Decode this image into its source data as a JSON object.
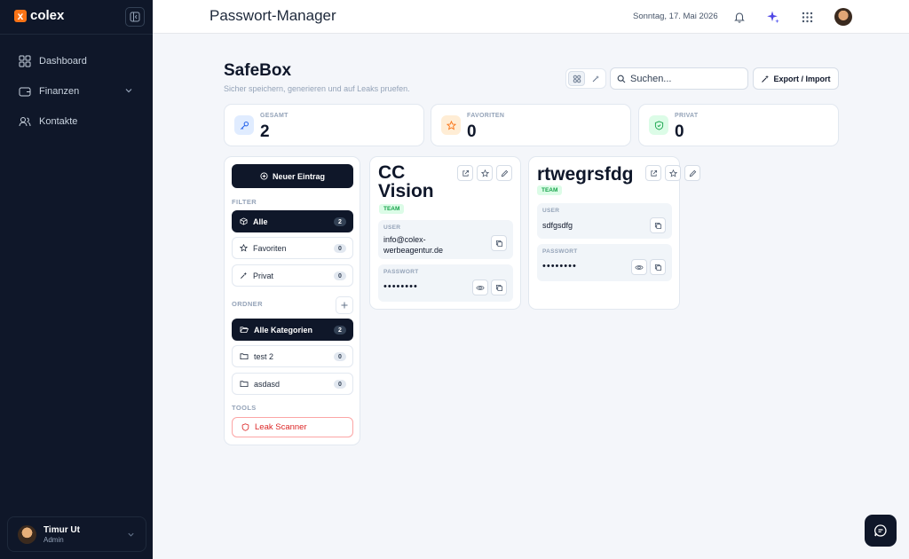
{
  "sidebar": {
    "brand": "colex",
    "brand_mark": "x",
    "nav": [
      {
        "label": "Dashboard",
        "icon": "dashboard-icon"
      },
      {
        "label": "Finanzen",
        "icon": "wallet-icon",
        "has_submenu": true
      },
      {
        "label": "Kontakte",
        "icon": "contacts-icon"
      }
    ],
    "user": {
      "name": "Timur Ut",
      "role": "Admin"
    }
  },
  "header": {
    "title": "Passwort-Manager",
    "date": "Sonntag, 17. Mai 2026"
  },
  "safebox": {
    "title": "SafeBox",
    "subtitle": "Sicher speichern, generieren und auf Leaks pruefen.",
    "search_placeholder": "Suchen...",
    "export_label": "Export / Import"
  },
  "stats": [
    {
      "label": "GESAMT",
      "value": "2",
      "color": "#2563eb"
    },
    {
      "label": "FAVORITEN",
      "value": "0",
      "color": "#f97316"
    },
    {
      "label": "PRIVAT",
      "value": "0",
      "color": "#16a34a"
    }
  ],
  "panel": {
    "new_entry": "Neuer Eintrag",
    "filter_label": "FILTER",
    "filters": [
      {
        "label": "Alle",
        "count": "2"
      },
      {
        "label": "Favoriten",
        "count": "0"
      },
      {
        "label": "Privat",
        "count": "0"
      }
    ],
    "folder_label": "ORDNER",
    "folders": [
      {
        "label": "Alle Kategorien",
        "count": "2"
      },
      {
        "label": "test 2",
        "count": "0"
      },
      {
        "label": "asdasd",
        "count": "0"
      }
    ],
    "tools_label": "TOOLS",
    "leak_scanner": "Leak Scanner"
  },
  "entries": [
    {
      "title_line1": "CC",
      "title_line2": "Vision",
      "badge": "TEAM",
      "user_label": "USER",
      "user_line1": "info@colex-",
      "user_line2": "werbeagentur.de",
      "password_label": "PASSWORT",
      "password": "••••••••"
    },
    {
      "title": "rtwegrsfdg",
      "badge": "TEAM",
      "user_label": "USER",
      "user": "sdfgsdfg",
      "password_label": "PASSWORT",
      "password": "••••••••"
    }
  ]
}
